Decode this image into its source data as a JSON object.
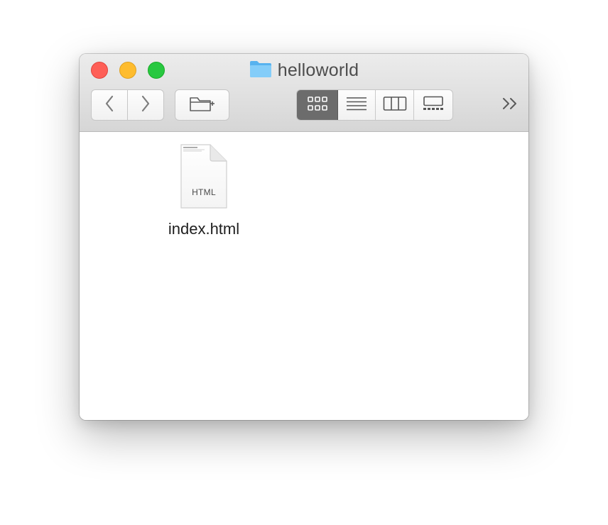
{
  "window": {
    "title": "helloworld"
  },
  "toolbar": {
    "back": "back",
    "forward": "forward",
    "new_folder": "new-folder",
    "views": [
      "icon-view",
      "list-view",
      "column-view",
      "gallery-view"
    ],
    "active_view": "icon-view"
  },
  "files": [
    {
      "name": "index.html",
      "kind": "HTML"
    }
  ],
  "colors": {
    "close": "#fe5f57",
    "minimize": "#febc2e",
    "maximize": "#28c840",
    "folder": "#6ec2f5",
    "active_segment": "#6c6c6c"
  }
}
